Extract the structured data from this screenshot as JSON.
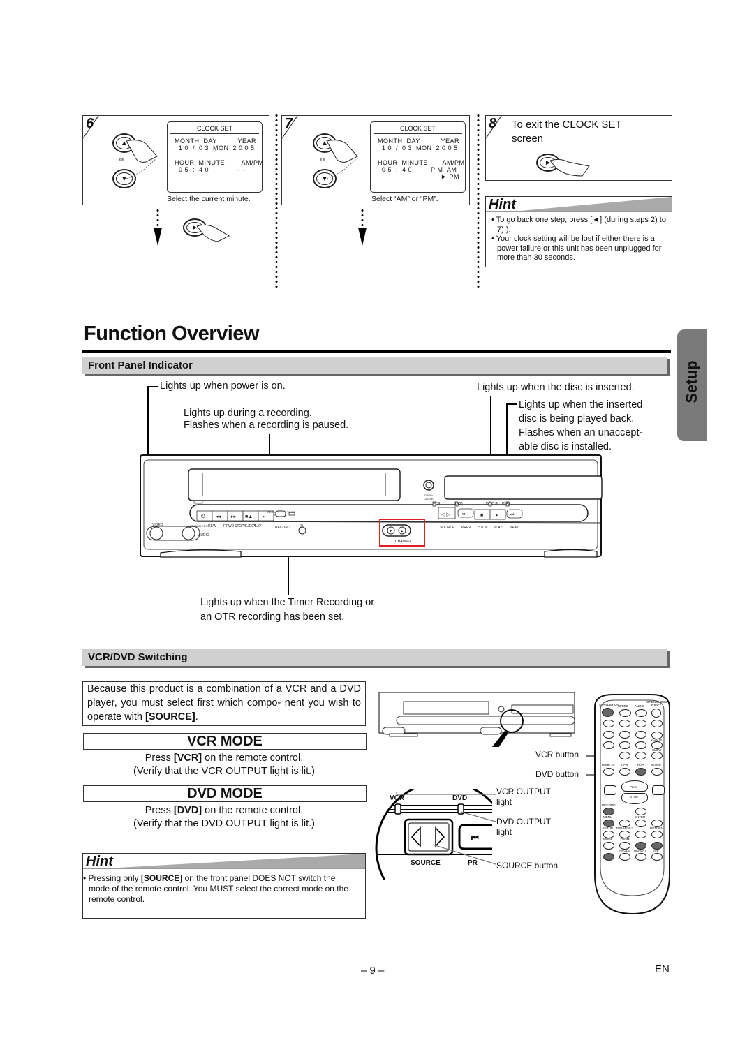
{
  "steps": [
    {
      "number": "6",
      "lcd": {
        "title": "CLOCK SET",
        "row1_labels": "MONTH  DAY          YEAR",
        "row1_values": "  1 0  /  0 3  MON  2 0 0 5",
        "row2_labels": "HOUR  MINUTE        AM/PM",
        "row2_values": "  0 5  :  4 0             – –"
      },
      "or_label": "or",
      "caption": "Select the current minute."
    },
    {
      "number": "7",
      "lcd": {
        "title": "CLOCK SET",
        "row1_labels": "MONTH  DAY          YEAR",
        "row1_values": "  1 0  /  0 3  MON  2 0 0 5",
        "row2_labels": "HOUR  MINUTE       AM/PM",
        "row2_values": "  0 5  :  4 0         P M  AM",
        "row3_values": "► PM"
      },
      "or_label": "or",
      "caption": "Select “AM” or “PM”."
    },
    {
      "number": "8",
      "text": "To exit the CLOCK SET screen"
    }
  ],
  "hint_top": {
    "title": "Hint",
    "bullets": [
      "• To go back one step, press [◄] (during steps 2) to 7) ).",
      "• Your clock setting will be lost if either there is a power failure or this unit has been unplugged for more than 30 seconds."
    ]
  },
  "section_title": "Function Overview",
  "side_tab": "Setup",
  "front_panel": {
    "heading": "Front Panel Indicator",
    "callouts": {
      "power": "Lights up when power is on.",
      "rec_1": "Lights up during a recording.",
      "rec_2": "Flashes when a recording is paused.",
      "disc_in": "Lights up when the disc is inserted.",
      "play_1": "Lights up when the inserted",
      "play_2": "disc is being played back.",
      "play_3": "Flashes when an unaccept-",
      "play_4": "able disc is installed.",
      "timer_1": "Lights up when the Timer Recording or",
      "timer_2": "an OTR recording has been set."
    },
    "device_labels": {
      "video": "VIDEO",
      "audio": "AUDIO",
      "standby": "STANDBY-ON",
      "rew": "REW",
      "ffwd": "F.FWD",
      "stop_eject": "STOP/EJECT",
      "play": "PLAY",
      "rec": "REC",
      "record": "RECORD",
      "timer": "TIMER",
      "ir": "IR",
      "open_close": "OPEN/ CLOSE",
      "vcr": "VCR",
      "dvd": "DVD",
      "disc_in": "DISC IN",
      "play_led": "PLAY",
      "channel": "CHANNEL",
      "source": "SOURCE",
      "prev": "PREV",
      "stop": "STOP",
      "dvd_play": "PLAY",
      "next": "NEXT"
    }
  },
  "switching": {
    "heading": "VCR/DVD Switching",
    "intro_pre": "Because this product is a combination of a VCR and a DVD player, you must select first which compo- nent you wish to operate with ",
    "intro_bold": "[SOURCE]",
    "intro_post": ".",
    "vcr_mode": {
      "title": "VCR MODE",
      "line1_pre": "Press ",
      "line1_bold": "[VCR]",
      "line1_post": " on the remote control.",
      "line2": "(Verify that the VCR OUTPUT light is lit.)"
    },
    "dvd_mode": {
      "title": "DVD MODE",
      "line1_pre": "Press ",
      "line1_bold": "[DVD]",
      "line1_post": " on the remote control.",
      "line2": "(Verify that the DVD OUTPUT light is lit.)"
    },
    "hint": {
      "title": "Hint",
      "pre": "• Pressing only ",
      "bold": "[SOURCE]",
      "post": " on the front panel DOES NOT switch the mode of the remote control. You MUST select the correct mode on the remote control."
    },
    "callouts": {
      "vcr_button": "VCR button",
      "dvd_button": "DVD button",
      "vcr_output": "VCR OUTPUT light",
      "dvd_output": "DVD OUTPUT light",
      "source_button": "SOURCE button"
    },
    "zoom_labels": {
      "vcr": "VCR",
      "dvd": "DVD",
      "source": "SOURCE",
      "prev_partial": "PR"
    },
    "remote_labels": [
      "STANDBY-ON",
      "SPEED",
      "AUDIO",
      "OPEN/CLOSE EJECT",
      "DISPLAY",
      "VCR",
      "DVD",
      "PAUSE",
      "VCR/TV",
      "SLOW",
      "RECORD",
      "MENU",
      "ENTER",
      "SETUP",
      "TOP MENU",
      "RETURN",
      "MODE",
      "ZOOM",
      "REPEAT",
      "A-B",
      "ANGLE",
      "PLAY",
      "STOP"
    ]
  },
  "footer": {
    "page": "– 9 –",
    "lang": "EN"
  },
  "colors": {
    "highlight_red": "#e02020",
    "section_gray": "#d0d0d0",
    "tab_gray": "#7a7a7a"
  }
}
